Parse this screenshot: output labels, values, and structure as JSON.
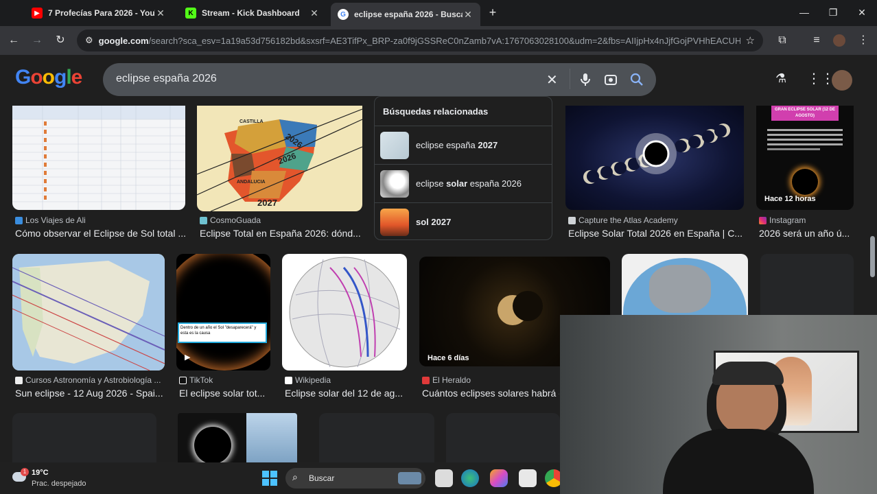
{
  "tabs": [
    {
      "title": "7 Profecías Para 2026 - YouTube",
      "favicon": "youtube-icon",
      "color": "#ff0000"
    },
    {
      "title": "Stream - Kick Dashboard",
      "favicon": "kick-icon",
      "color": "#53fc18"
    },
    {
      "title": "eclipse españa 2026 - Buscar con Google",
      "favicon": "google-icon",
      "color": "#ffffff"
    }
  ],
  "toolbar": {
    "url_domain": "google.com",
    "url_rest": "/search?sca_esv=1a19a53d756182bd&sxsrf=AE3TifPx_BRP-za0f9jGSSReC0nZamb7vA:1767063028100&udm=2&fbs=AIIjpHx4nJjfGojPVHhEACUHPi..."
  },
  "search": {
    "query": "eclipse españa 2026"
  },
  "results_row1": [
    {
      "source": "Los Viajes de Ali",
      "caption": "Cómo observar el Eclipse de Sol total ..."
    },
    {
      "source": "CosmoGuada",
      "caption": "Eclipse Total en España 2026: dónd..."
    },
    {
      "source": "Capture the Atlas Academy",
      "caption": "Eclipse Solar Total 2026 en España | C..."
    },
    {
      "source": "Instagram",
      "caption": "2026 será un año ú...",
      "badge": "Hace 12 horas"
    }
  ],
  "related": {
    "heading": "Búsquedas relacionadas",
    "items": [
      {
        "pre": "eclipse españa ",
        "bold": "2027",
        "post": ""
      },
      {
        "pre": "eclipse ",
        "bold": "solar",
        "post": " españa 2026"
      },
      {
        "pre": "",
        "bold": "sol 2027",
        "post": ""
      }
    ]
  },
  "results_row2": [
    {
      "source": "Cursos Astronomía y Astrobiología ...",
      "caption": "Sun eclipse - 12 Aug 2026 - Spai..."
    },
    {
      "source": "TikTok",
      "caption": "El eclipse solar tot...",
      "overlay": "Dentro de un año el Sol \"desaparecerá\" y esta es la causa"
    },
    {
      "source": "Wikipedia",
      "caption": "Eclipse solar del 12 de ag..."
    },
    {
      "source": "El Heraldo",
      "caption": "Cuántos eclipses solares habrá e",
      "badge": "Hace 6 días"
    }
  ],
  "thumb_labels": {
    "map_year_1": "2026",
    "map_year_2": "2026",
    "map_year_3": "2027",
    "map_region_1": "CASTILLA",
    "map_region_2": "ANDALUCIA",
    "insta_title": "GRAN ECLIPSE SOLAR (12 DE AGOSTO)"
  },
  "weather": {
    "temp": "19°C",
    "desc": "Prac. despejado",
    "alert": "1"
  },
  "taskbar": {
    "search_label": "Buscar"
  }
}
